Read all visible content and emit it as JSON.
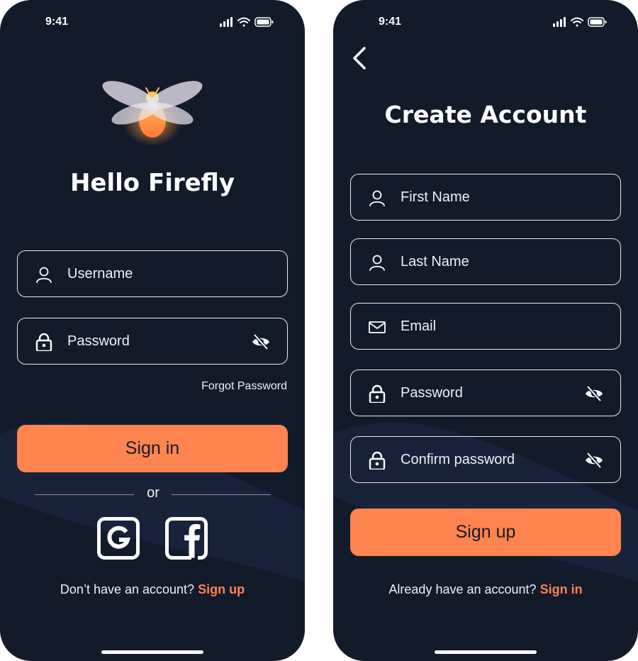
{
  "status_bar": {
    "time": "9:41"
  },
  "signin": {
    "title": "Hello Firefly",
    "username_placeholder": "Username",
    "password_placeholder": "Password",
    "forgot_password": "Forgot Password",
    "signin_button": "Sign in",
    "divider_text": "or",
    "footer_prompt": "Don’t have an account?",
    "footer_link": "Sign up"
  },
  "signup": {
    "title": "Create Account",
    "first_name_placeholder": "First Name",
    "last_name_placeholder": "Last Name",
    "email_placeholder": "Email",
    "password_placeholder": "Password",
    "confirm_password_placeholder": "Confirm password",
    "signup_button": "Sign up",
    "footer_prompt": "Already have an account?",
    "footer_link": "Sign in"
  },
  "colors": {
    "background": "#131a2a",
    "accent": "#ff8450",
    "field_border": "#e6e8ee",
    "text": "#ffffff"
  },
  "icons": {
    "user": "user-icon",
    "lock": "lock-icon",
    "mail": "mail-icon",
    "eye_off": "eye-off-icon",
    "google": "google-icon",
    "facebook": "facebook-icon",
    "back": "chevron-left-icon",
    "logo": "firefly-logo"
  }
}
